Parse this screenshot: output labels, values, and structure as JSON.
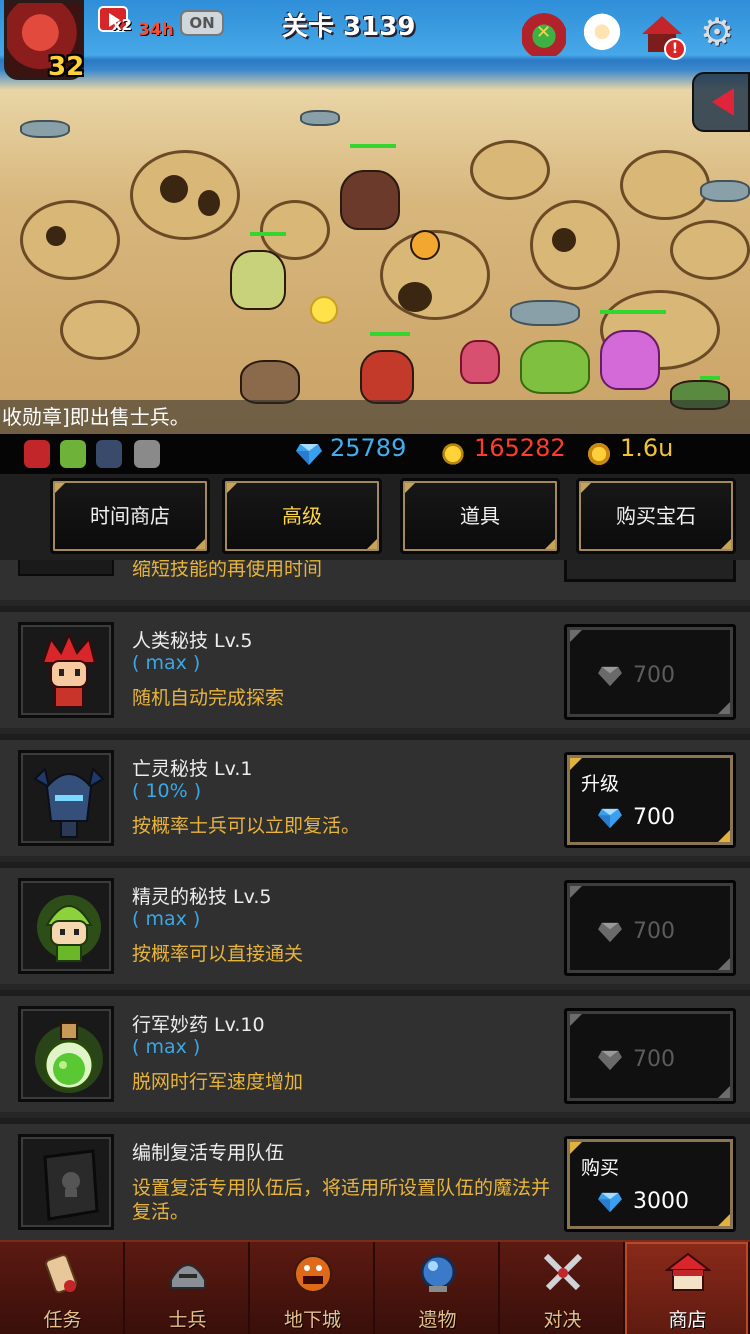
{
  "hud": {
    "player_level": "32",
    "speed_multiplier": "x2",
    "speed_time": "34h",
    "speed_toggle": "ON",
    "stage_title": "关卡 3139"
  },
  "ticker": {
    "message": "收勋章]即出售士兵。"
  },
  "resources": {
    "gems": "25789",
    "medals": "165282",
    "gold": "1.6u"
  },
  "tabs": [
    {
      "label": "时间商店",
      "active": false
    },
    {
      "label": "高级",
      "active": true
    },
    {
      "label": "道具",
      "active": false
    },
    {
      "label": "购买宝石",
      "active": false
    }
  ],
  "partial_row": {
    "desc": "缩短技能的再使用时间"
  },
  "items": [
    {
      "icon": "human-skill-icon",
      "title": "人类秘技 Lv.5",
      "sub": "( max )",
      "desc": "随机自动完成探索",
      "button_label": "",
      "price": "700",
      "enabled": false
    },
    {
      "icon": "undead-skill-icon",
      "title": "亡灵秘技 Lv.1",
      "sub": "( 10% )",
      "desc": "按概率士兵可以立即复活。",
      "button_label": "升级",
      "price": "700",
      "enabled": true
    },
    {
      "icon": "elf-skill-icon",
      "title": "精灵的秘技 Lv.5",
      "sub": "( max )",
      "desc": "按概率可以直接通关",
      "button_label": "",
      "price": "700",
      "enabled": false
    },
    {
      "icon": "march-potion-icon",
      "title": "行军妙药 Lv.10",
      "sub": "( max )",
      "desc": "脱网时行军速度增加",
      "button_label": "",
      "price": "700",
      "enabled": false
    },
    {
      "icon": "revive-book-icon",
      "title": "编制复活专用队伍",
      "sub": "",
      "desc": "设置复活专用队伍后，将适用所设置队伍的魔法并复活。",
      "button_label": "购买",
      "price": "3000",
      "enabled": true
    }
  ],
  "nav": [
    {
      "label": "任务",
      "icon": "scroll-icon",
      "active": false
    },
    {
      "label": "士兵",
      "icon": "helmet-icon",
      "active": false
    },
    {
      "label": "地下城",
      "icon": "dungeon-monster-icon",
      "active": false
    },
    {
      "label": "遗物",
      "icon": "relic-orb-icon",
      "active": false
    },
    {
      "label": "对决",
      "icon": "crossed-swords-icon",
      "active": false
    },
    {
      "label": "商店",
      "icon": "shop-icon",
      "active": true
    }
  ],
  "colors": {
    "gem_blue": "#41aef0",
    "medal_red": "#ff3b2b",
    "gold_yellow": "#f2c233",
    "desc_gold": "#e8b43a",
    "sub_blue": "#39a8e6"
  }
}
